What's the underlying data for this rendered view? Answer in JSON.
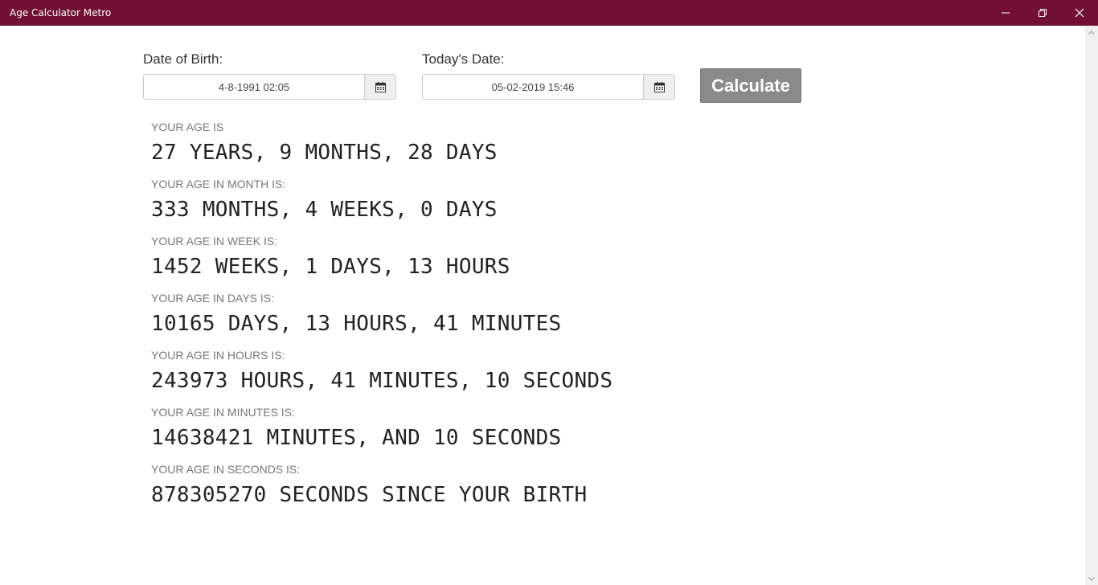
{
  "window": {
    "title": "Age Calculator Metro",
    "controls": [
      "minimize-icon",
      "restore-icon",
      "close-icon"
    ],
    "titlebar_color": "#711033"
  },
  "form": {
    "dob_label": "Date of Birth:",
    "dob_value": "4-8-1991 02:05",
    "today_label": "Today's Date:",
    "today_value": "05-02-2019 15:46",
    "calendar_icon": "calendar-icon",
    "calculate_label": "Calculate"
  },
  "results": [
    {
      "label": "YOUR AGE IS",
      "value": "27 YEARS, 9 MONTHS, 28 DAYS"
    },
    {
      "label": "YOUR AGE IN MONTH IS:",
      "value": "333 MONTHS, 4 WEEKS, 0 DAYS"
    },
    {
      "label": "YOUR AGE IN WEEK IS:",
      "value": "1452 WEEKS, 1 DAYS, 13 HOURS"
    },
    {
      "label": "YOUR AGE IN DAYS IS:",
      "value": "10165 DAYS, 13 HOURS, 41 MINUTES"
    },
    {
      "label": "YOUR AGE IN HOURS IS:",
      "value": "243973 HOURS, 41 MINUTES, 10 SECONDS"
    },
    {
      "label": "YOUR AGE IN MINUTES IS:",
      "value": "14638421 MINUTES, AND 10 SECONDS"
    },
    {
      "label": "YOUR AGE IN SECONDS IS:",
      "value": "878305270 SECONDS SINCE YOUR BIRTH"
    }
  ]
}
